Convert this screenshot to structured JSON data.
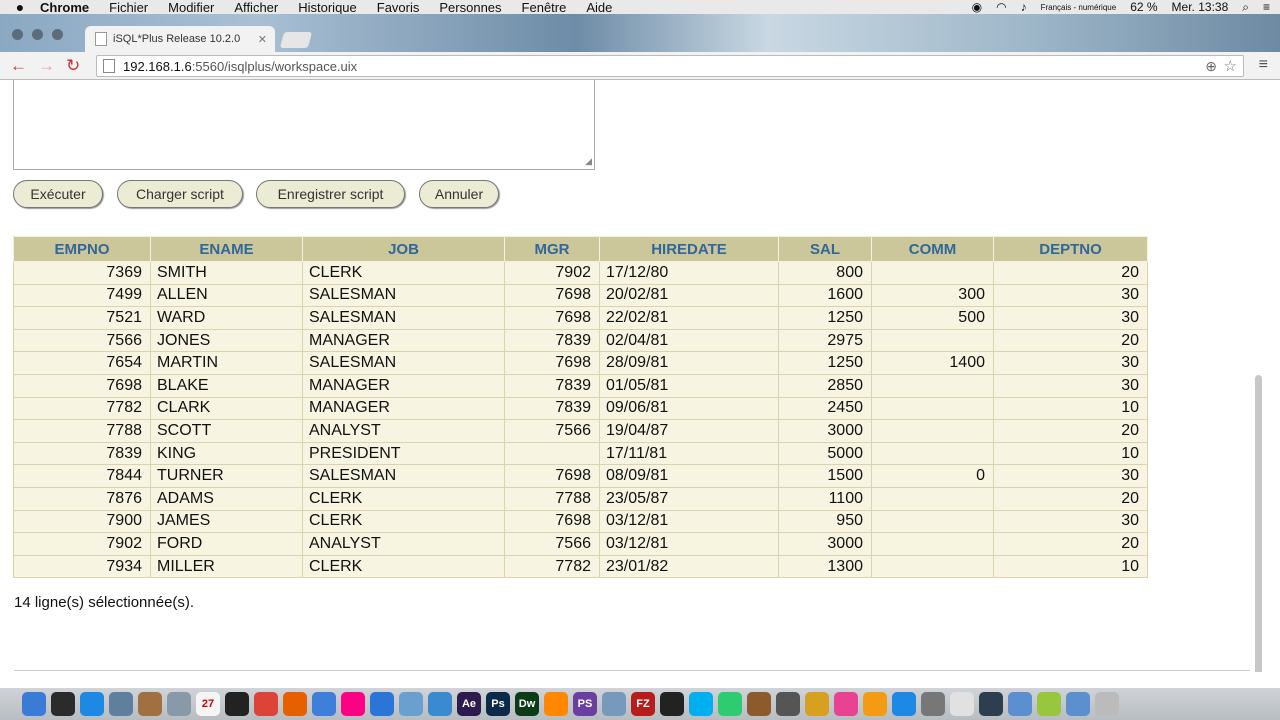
{
  "menubar": {
    "app": "Chrome",
    "items": [
      "Fichier",
      "Modifier",
      "Afficher",
      "Historique",
      "Favoris",
      "Personnes",
      "Fenêtre",
      "Aide"
    ],
    "input_source": "Français - numérique",
    "battery": "62 %",
    "clock": "Mer. 13:38"
  },
  "browser": {
    "tab_title": "iSQL*Plus Release 10.2.0",
    "url_host": "192.168.1.6",
    "url_path": ":5560/isqlplus/workspace.uix"
  },
  "buttons": {
    "execute": "Exécuter",
    "load_script": "Charger script",
    "save_script": "Enregistrer script",
    "cancel": "Annuler"
  },
  "table": {
    "headers": [
      "EMPNO",
      "ENAME",
      "JOB",
      "MGR",
      "HIREDATE",
      "SAL",
      "COMM",
      "DEPTNO"
    ],
    "rows": [
      [
        "7369",
        "SMITH",
        "CLERK",
        "7902",
        "17/12/80",
        "800",
        "",
        "20"
      ],
      [
        "7499",
        "ALLEN",
        "SALESMAN",
        "7698",
        "20/02/81",
        "1600",
        "300",
        "30"
      ],
      [
        "7521",
        "WARD",
        "SALESMAN",
        "7698",
        "22/02/81",
        "1250",
        "500",
        "30"
      ],
      [
        "7566",
        "JONES",
        "MANAGER",
        "7839",
        "02/04/81",
        "2975",
        "",
        "20"
      ],
      [
        "7654",
        "MARTIN",
        "SALESMAN",
        "7698",
        "28/09/81",
        "1250",
        "1400",
        "30"
      ],
      [
        "7698",
        "BLAKE",
        "MANAGER",
        "7839",
        "01/05/81",
        "2850",
        "",
        "30"
      ],
      [
        "7782",
        "CLARK",
        "MANAGER",
        "7839",
        "09/06/81",
        "2450",
        "",
        "10"
      ],
      [
        "7788",
        "SCOTT",
        "ANALYST",
        "7566",
        "19/04/87",
        "3000",
        "",
        "20"
      ],
      [
        "7839",
        "KING",
        "PRESIDENT",
        "",
        "17/11/81",
        "5000",
        "",
        "10"
      ],
      [
        "7844",
        "TURNER",
        "SALESMAN",
        "7698",
        "08/09/81",
        "1500",
        "0",
        "30"
      ],
      [
        "7876",
        "ADAMS",
        "CLERK",
        "7788",
        "23/05/87",
        "1100",
        "",
        "20"
      ],
      [
        "7900",
        "JAMES",
        "CLERK",
        "7698",
        "03/12/81",
        "950",
        "",
        "30"
      ],
      [
        "7902",
        "FORD",
        "ANALYST",
        "7566",
        "03/12/81",
        "3000",
        "",
        "20"
      ],
      [
        "7934",
        "MILLER",
        "CLERK",
        "7782",
        "23/01/82",
        "1300",
        "",
        "10"
      ]
    ]
  },
  "status": "14 ligne(s) sélectionnée(s).",
  "dock": {
    "icons": [
      "finder-icon",
      "dashboard-icon",
      "safari-icon",
      "preview-icon",
      "notes-icon",
      "launchpad-icon",
      "calendar-icon",
      "inkscape-icon",
      "chrome-icon",
      "firefox-icon",
      "pages-icon",
      "flickr-icon",
      "xcode-icon",
      "box-icon",
      "info-icon",
      "after-effects-icon",
      "photoshop-icon",
      "dreamweaver-icon",
      "vlc-icon",
      "phpstorm-icon",
      "folder-icon",
      "filezilla-icon",
      "terminal-icon",
      "skype-icon",
      "messages-icon",
      "guitar-icon",
      "grid-icon",
      "chrome-canary-icon",
      "itunes-icon",
      "ibooks-icon",
      "appstore-icon",
      "system-prefs-icon",
      "photo-icon",
      "quicktime-icon",
      "downloads-icon",
      "android-icon",
      "folder2-icon",
      "trash-icon"
    ],
    "labels": {
      "calendar": "27",
      "after_effects": "Ae",
      "photoshop": "Ps",
      "dreamweaver": "Dw",
      "phpstorm": "PS",
      "filezilla": "FZ"
    }
  }
}
